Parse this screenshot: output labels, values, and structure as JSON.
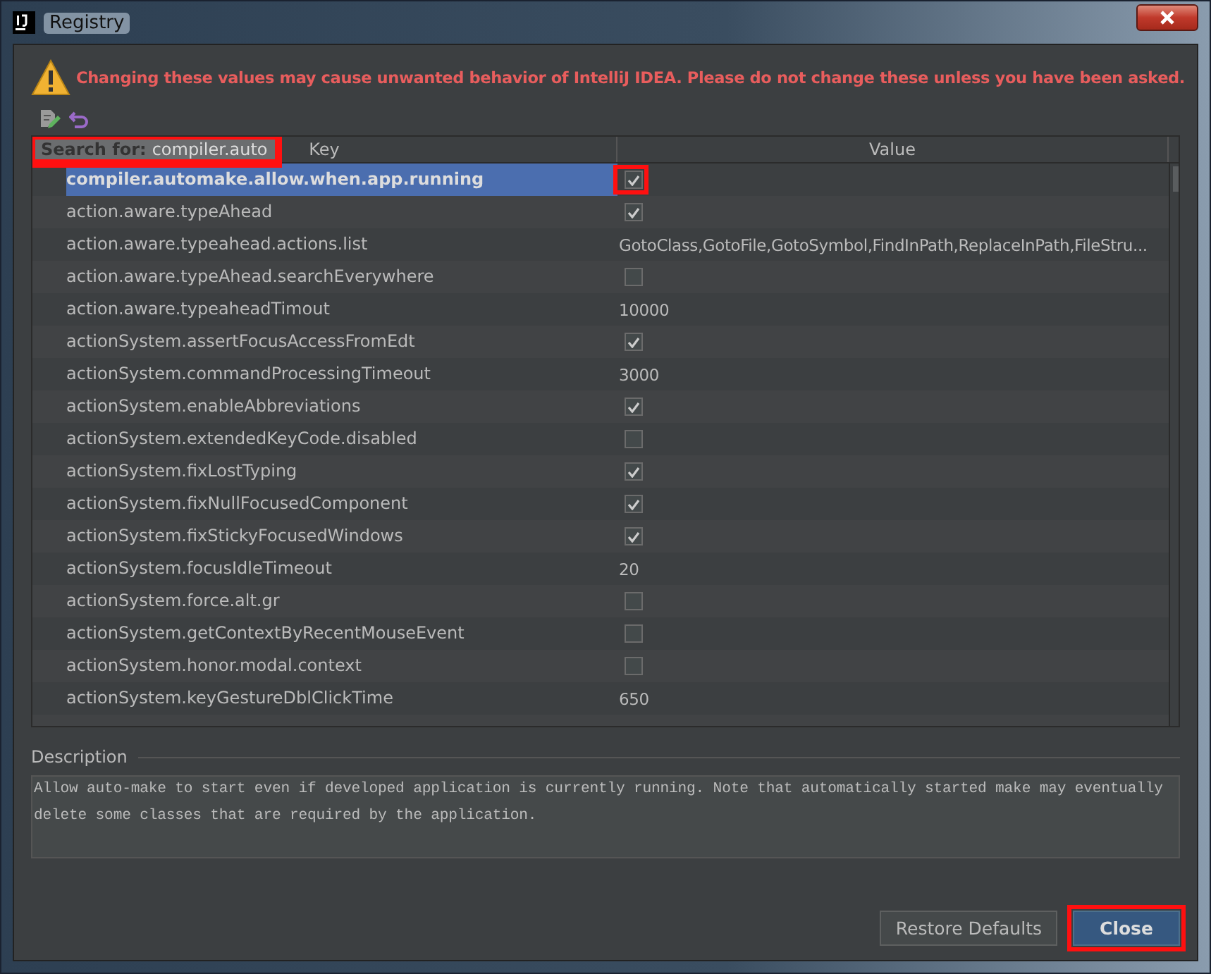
{
  "window": {
    "title": "Registry"
  },
  "warning": "Changing these values may cause unwanted behavior of IntelliJ IDEA. Please do not change these unless you have been asked.",
  "search": {
    "label": "Search for:",
    "value": "compiler.auto",
    "highlighted": true
  },
  "table": {
    "columns": [
      "Key",
      "Value"
    ],
    "rows": [
      {
        "key": "compiler.automake.allow.when.app.running",
        "kind": "checkbox",
        "checked": true,
        "selected": true,
        "highlighted": true
      },
      {
        "key": "action.aware.typeAhead",
        "kind": "checkbox",
        "checked": true,
        "selected": false,
        "highlighted": false
      },
      {
        "key": "action.aware.typeahead.actions.list",
        "kind": "text",
        "value": "GotoClass,GotoFile,GotoSymbol,FindInPath,ReplaceInPath,FileStru...",
        "selected": false,
        "highlighted": false
      },
      {
        "key": "action.aware.typeAhead.searchEverywhere",
        "kind": "checkbox",
        "checked": false,
        "selected": false,
        "highlighted": false
      },
      {
        "key": "action.aware.typeaheadTimout",
        "kind": "text",
        "value": "10000",
        "selected": false,
        "highlighted": false
      },
      {
        "key": "actionSystem.assertFocusAccessFromEdt",
        "kind": "checkbox",
        "checked": true,
        "selected": false,
        "highlighted": false
      },
      {
        "key": "actionSystem.commandProcessingTimeout",
        "kind": "text",
        "value": "3000",
        "selected": false,
        "highlighted": false
      },
      {
        "key": "actionSystem.enableAbbreviations",
        "kind": "checkbox",
        "checked": true,
        "selected": false,
        "highlighted": false
      },
      {
        "key": "actionSystem.extendedKeyCode.disabled",
        "kind": "checkbox",
        "checked": false,
        "selected": false,
        "highlighted": false
      },
      {
        "key": "actionSystem.fixLostTyping",
        "kind": "checkbox",
        "checked": true,
        "selected": false,
        "highlighted": false
      },
      {
        "key": "actionSystem.fixNullFocusedComponent",
        "kind": "checkbox",
        "checked": true,
        "selected": false,
        "highlighted": false
      },
      {
        "key": "actionSystem.fixStickyFocusedWindows",
        "kind": "checkbox",
        "checked": true,
        "selected": false,
        "highlighted": false
      },
      {
        "key": "actionSystem.focusIdleTimeout",
        "kind": "text",
        "value": "20",
        "selected": false,
        "highlighted": false
      },
      {
        "key": "actionSystem.force.alt.gr",
        "kind": "checkbox",
        "checked": false,
        "selected": false,
        "highlighted": false
      },
      {
        "key": "actionSystem.getContextByRecentMouseEvent",
        "kind": "checkbox",
        "checked": false,
        "selected": false,
        "highlighted": false
      },
      {
        "key": "actionSystem.honor.modal.context",
        "kind": "checkbox",
        "checked": false,
        "selected": false,
        "highlighted": false
      },
      {
        "key": "actionSystem.keyGestureDblClickTime",
        "kind": "text",
        "value": "650",
        "selected": false,
        "highlighted": false
      }
    ]
  },
  "description": {
    "label": "Description",
    "text": "Allow auto-make to start even if developed application is currently running. Note that automatically started make may eventually delete some classes that are required by the application."
  },
  "buttons": [
    {
      "label": "Restore Defaults",
      "default": false,
      "highlighted": false
    },
    {
      "label": "Close",
      "default": true,
      "highlighted": true
    }
  ]
}
